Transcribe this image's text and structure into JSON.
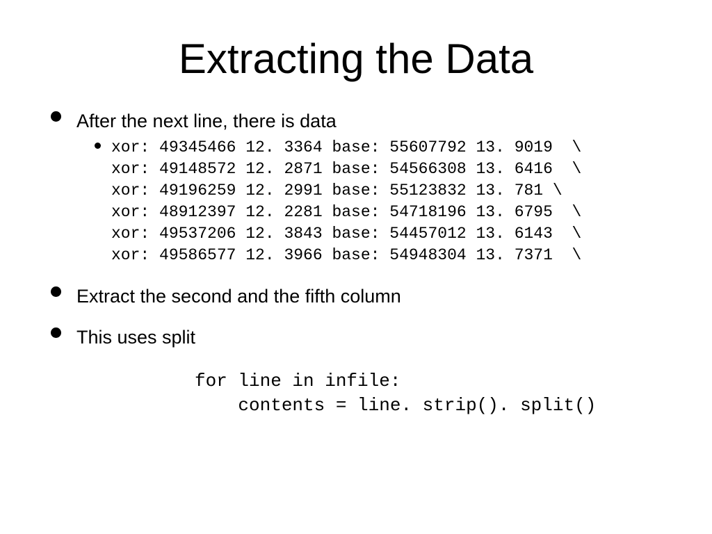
{
  "title": "Extracting the Data",
  "bullets": {
    "b1": "After the next line, there is data",
    "b2": "Extract the second and the fifth column",
    "b3": "This uses split"
  },
  "data_rows": [
    "xor: 49345466 12. 3364 base: 55607792 13. 9019  \\",
    "xor: 49148572 12. 2871 base: 54566308 13. 6416  \\",
    "xor: 49196259 12. 2991 base: 55123832 13. 781 \\",
    "xor: 48912397 12. 2281 base: 54718196 13. 6795  \\",
    "xor: 49537206 12. 3843 base: 54457012 13. 6143  \\",
    "xor: 49586577 12. 3966 base: 54948304 13. 7371  \\"
  ],
  "code": "for line in infile:\n    contents = line. strip(). split()"
}
